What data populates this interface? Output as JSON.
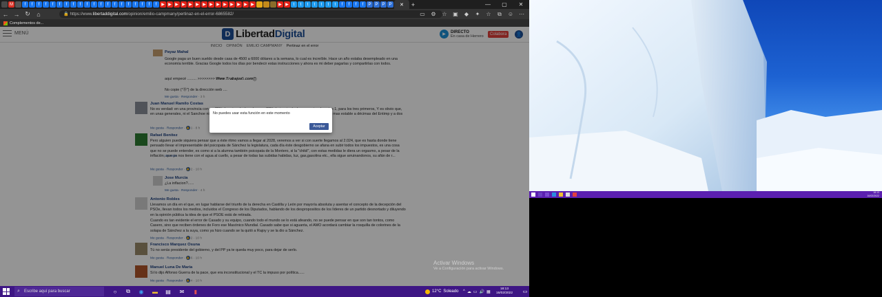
{
  "browser": {
    "url_prefix": "https://www.",
    "url_domain": "libertaddigital.com",
    "url_path": "/opinion/emilio-campmany/pertinaz-en-el-error-6865582/",
    "favorites_label": "Complementos de..."
  },
  "site": {
    "menu_label": "MENÚ",
    "logo_text_1": "Libertad",
    "logo_text_2": "Digital",
    "live_title": "DIRECTO",
    "live_subtitle": "En casa de Herrero",
    "colabora_label": "Colabora",
    "breadcrumb": [
      "INICIO",
      "OPINIÓN",
      "EMILIO CAMPMANY",
      "Pertinaz en el error"
    ]
  },
  "comments": [
    {
      "name": "Payaz Mahal",
      "text": "Google paga un buen sueldo desde casa de 4500 a 6000 dólares a la semana, lo cual es increíble. Hace un año estaba desempleado en una economía terrible. Gracias Google todos los días por bendecir estas instrucciones y ahora es mi deber pagarlas y compartirlas con todos.",
      "text2": "aquí empecé ......... >>>>>>>> 𝑾𝒘𝒘.𝑻𝒓𝒂𝒃𝒂𝒋𝒐𝒔5.𝒄𝒐𝒎Ⓞ",
      "text3": "No copie (\"Ⓞ\") de la dirección web ....",
      "meta_like": "Me gusta",
      "meta_reply": "Responder",
      "meta_time": "3 h"
    },
    {
      "name": "Juan Manuel Ramilo Costas",
      "text": "No es verdad: en una provincia con un 70% de votos de derecha y un 30% de izquierda, la proporcion de votos 1, para los tres primeros, Y es obvio que, en unas generales, ni el Sanchoe ni el PSOE llegan a donde estaban, lo que sus seguidores que aspiraban, la mas estable a décimas del Entimp y a dos puntos del Sanchoe, es decir, en triple empate...",
      "meta_like": "Me gusta",
      "meta_reply": "Responder",
      "meta_count": "1",
      "meta_time": "8 h"
    },
    {
      "name": "Rafael Benitez",
      "text": "Pero alguien puede siquiera pensar que a éste ritmo vamos a llegar al 2028, veremos a ver si con suerte llegamos al 2.024, que es hasta donde tiene pensado llevar el impresentable del psicopata de Sánchez la legislatura, cada día éste desgobierno se afana en subir todos los impuestos, es una cosa que no se puede entender, es como si a la alumna también psicopata de la Montero, si la \"chikil\", con estas medidas le diera un orgasmo, a pesar de la inflación, que ya nos tiene con el agua al cuello, a pesar de todas las subidas habidas, luz, gas,gasolina etc., ella sigue arruinandonos, su afán de r...",
      "more": "Ver más",
      "meta_like": "Me gusta",
      "meta_reply": "Responder",
      "meta_count": "2",
      "meta_time": "10 h"
    },
    {
      "name": "Jose Murcia",
      "text": "¿La inflacion?......",
      "meta_like": "Me gusta",
      "meta_reply": "Responder",
      "meta_time": "4 h"
    },
    {
      "name": "Antonio Robles",
      "text": "Llevamos un día en el que, en lugar hablarse del triunfo de la derecha en Castilla y León por mayoría absoluta y asentar el concepto de la decepción del PSOe, llevan todos los medios, incluidos el Congreso de los Diputados, hablando de los desproposiitos de los líderes de un partido desnortado y diluyendo en la opinión pública la idea de que el PSOE está de retirada.",
      "text2": "Cuando es tan evidente el error de Casado y su equipo, cuando todo el mundo se lo está afeando, no se puede pensar en que son tan tontos, como Casero, sino que reciben órdenes de Foro ese Masónico Mundial. Casado sabe que si aguanta, el AMO acordará cambiar la rosquilla de colorines de la solapa de Sánchez a la suya, como ya hizo cuando se la quitó a Rajoy y se la dio a Sánchez.",
      "meta_like": "Me gusta",
      "meta_reply": "Responder",
      "meta_count": "2",
      "meta_time": "10 h"
    },
    {
      "name": "Francisco Marquez Osuna",
      "text": "Tú no serás presidente del gobierno, y del PP ya te queda muy poco, para dejar de serlo.",
      "meta_like": "Me gusta",
      "meta_reply": "Responder",
      "meta_count": "6",
      "meta_time": "10 h"
    },
    {
      "name": "Manuel Luna De María",
      "text": "Si lo dijo Alfonso Guerra de la pace, que era inconstitucional y el TC la impuso por política......",
      "meta_like": "Me gusta",
      "meta_reply": "Responder",
      "meta_count": "4",
      "meta_time": "10 h"
    }
  ],
  "dialog": {
    "message": "No puedes usar esta función en este momento",
    "accept": "Aceptar"
  },
  "watermark": {
    "line1": "Activar Windows",
    "line2": "Ve a Configuración para activar Windows."
  },
  "taskbar": {
    "search_placeholder": "Escribe aquí para buscar",
    "temperature": "12°C",
    "weather": "Soleado",
    "time": "18:13",
    "date": "16/02/2022"
  },
  "wall_clock": {
    "time": "18:13",
    "date": "16/02/2022"
  }
}
